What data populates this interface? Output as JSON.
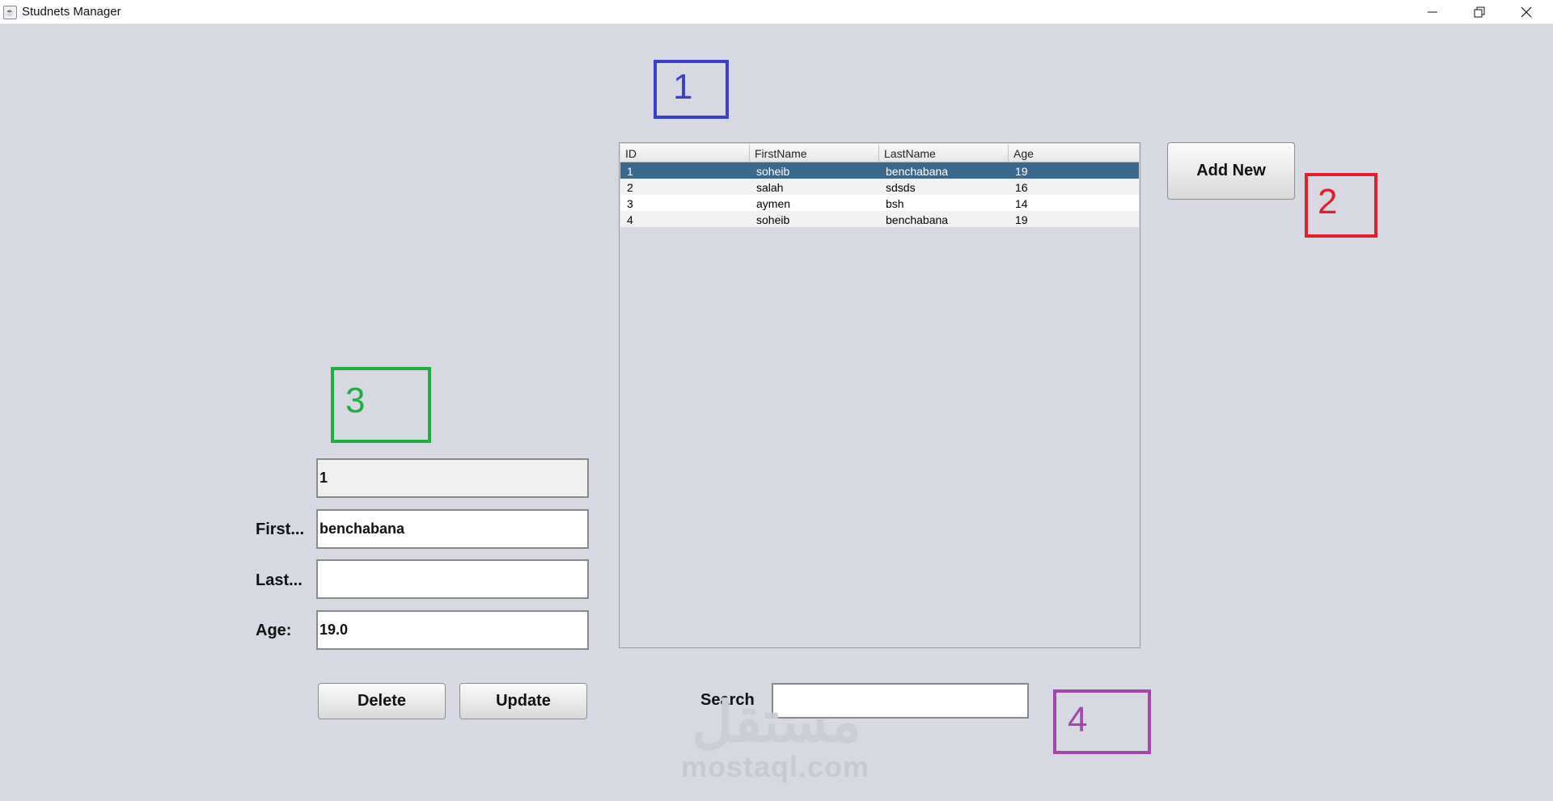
{
  "window": {
    "title": "Studnets Manager",
    "controls": [
      "minimize-icon",
      "restore-icon",
      "close-icon"
    ]
  },
  "markers": [
    {
      "label": "1",
      "color": "#3c3fc8"
    },
    {
      "label": "2",
      "color": "#e0202c"
    },
    {
      "label": "3",
      "color": "#1fae46"
    },
    {
      "label": "4",
      "color": "#a347a8"
    }
  ],
  "table": {
    "columns": [
      "ID",
      "FirstName",
      "LastName",
      "Age"
    ],
    "rows": [
      [
        "1",
        "soheib",
        "benchabana",
        "19"
      ],
      [
        "2",
        "salah",
        "sdsds",
        "16"
      ],
      [
        "3",
        "aymen",
        "bsh",
        "14"
      ],
      [
        "4",
        "soheib",
        "benchabana",
        "19"
      ]
    ],
    "selected_row_index": 0
  },
  "buttons": {
    "add_new": "Add New",
    "delete": "Delete",
    "update": "Update"
  },
  "form": {
    "id_value": "1",
    "first_label": "First...",
    "first_value": "benchabana",
    "last_label": "Last...",
    "last_value": "",
    "age_label": "Age:",
    "age_value": "19.0"
  },
  "search": {
    "label": "Search",
    "value": ""
  },
  "watermark": {
    "arabic": "مستقل",
    "latin": "mostaql.com"
  },
  "colors": {
    "background": "#d6d9e2",
    "selection": "#39698f"
  }
}
